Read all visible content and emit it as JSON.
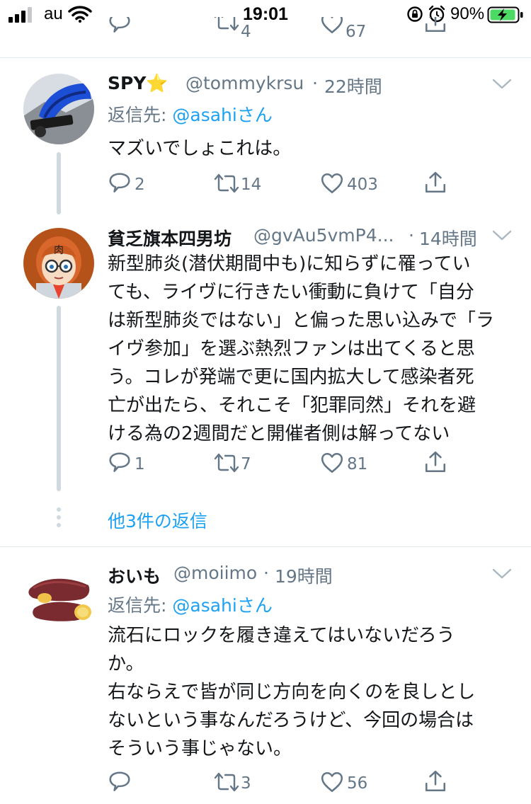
{
  "status_bar": {
    "carrier": "au",
    "time": "19:01",
    "battery": "90%"
  },
  "previous_tweet_actions": {
    "retweets": "4",
    "likes": "67"
  },
  "tweets": [
    {
      "name": "SPY⭐",
      "handle": "@tommykrsu",
      "time": "22時間",
      "reply_prefix": "返信先: ",
      "reply_to": "@asahiさん",
      "text": "マズいでしょこれは。",
      "replies": "2",
      "retweets": "14",
      "likes": "403"
    },
    {
      "name": "貧乏旗本四男坊",
      "handle": "@gvAu5vmP4...",
      "time": "14時間",
      "text": "新型肺炎(潜伏期間中も)に知らずに罹ってい\nても、ライヴに行きたい衝動に負けて「自分\nは新型肺炎ではない」と偏った思い込みで「ラ\nイヴ参加」を選ぶ熱烈ファンは出てくると思\nう。コレが発端で更に国内拡大して感染者死\n亡が出たら、それこそ「犯罪同然」それを避\nける為の2週間だと開催者側は解ってない",
      "replies": "1",
      "retweets": "7",
      "likes": "81"
    },
    {
      "name": "おいも",
      "handle": "@moiimo",
      "time": "19時間",
      "reply_prefix": "返信先: ",
      "reply_to": "@asahiさん",
      "text": "流石にロックを履き違えてはいないだろう\nか。\n右ならえで皆が同じ方向を向くのを良しとし\nないという事なんだろうけど、今回の場合は\nそういう事じゃない。",
      "replies": "",
      "retweets": "3",
      "likes": "56"
    }
  ],
  "more_replies": "他3件の返信",
  "avatar2_label": "肉",
  "colors": {
    "accent": "#1da1f2",
    "secondary_text": "#657786",
    "battery_green": "#4cd964"
  },
  "icons": [
    "signal-icon",
    "wifi-icon",
    "lock-rotation-icon",
    "alarm-icon",
    "battery-icon",
    "chevron-down-icon",
    "reply-icon",
    "retweet-icon",
    "like-icon",
    "share-icon"
  ]
}
